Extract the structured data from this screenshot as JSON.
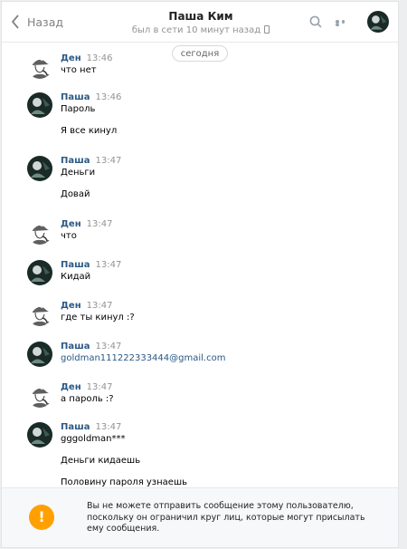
{
  "header": {
    "back_label": "Назад",
    "title": "Паша Ким",
    "subtitle": "был в сети 10 минут назад",
    "icons": {
      "back": "chevron-left-icon",
      "search": "search-icon",
      "more": "more-dots-icon"
    }
  },
  "date_pill": "сегодня",
  "messages": [
    {
      "author": "Ден",
      "time": "13:46",
      "avatar": "sherlock",
      "lines": [
        "что нет"
      ]
    },
    {
      "author": "Паша",
      "time": "13:46",
      "avatar": "photo",
      "lines": [
        "Пароль",
        "Я все кинул"
      ]
    },
    {
      "author": "Паша",
      "time": "13:47",
      "avatar": "photo",
      "lines": [
        "Деньги",
        "Довай"
      ]
    },
    {
      "author": "Ден",
      "time": "13:47",
      "avatar": "sherlock",
      "lines": [
        "что"
      ]
    },
    {
      "author": "Паша",
      "time": "13:47",
      "avatar": "photo",
      "lines": [
        "Кидай"
      ]
    },
    {
      "author": "Ден",
      "time": "13:47",
      "avatar": "sherlock",
      "lines": [
        "где ты кинул :?"
      ]
    },
    {
      "author": "Паша",
      "time": "13:47",
      "avatar": "photo",
      "lines": [
        "goldman111222333444@gmail.com"
      ]
    },
    {
      "author": "Ден",
      "time": "13:47",
      "avatar": "sherlock",
      "lines": [
        "а пароль :?"
      ]
    },
    {
      "author": "Паша",
      "time": "13:47",
      "avatar": "photo",
      "lines": [
        "gggoldman***",
        "Деньги кидаешь",
        "Половину пароля узнаешь"
      ]
    }
  ],
  "notice": {
    "icon": "warning-icon",
    "color": "#ffa000",
    "text": "Вы не можете отправить сообщение этому пользователю, поскольку он ограничил круг лиц, которые могут присылать ему сообщения."
  }
}
